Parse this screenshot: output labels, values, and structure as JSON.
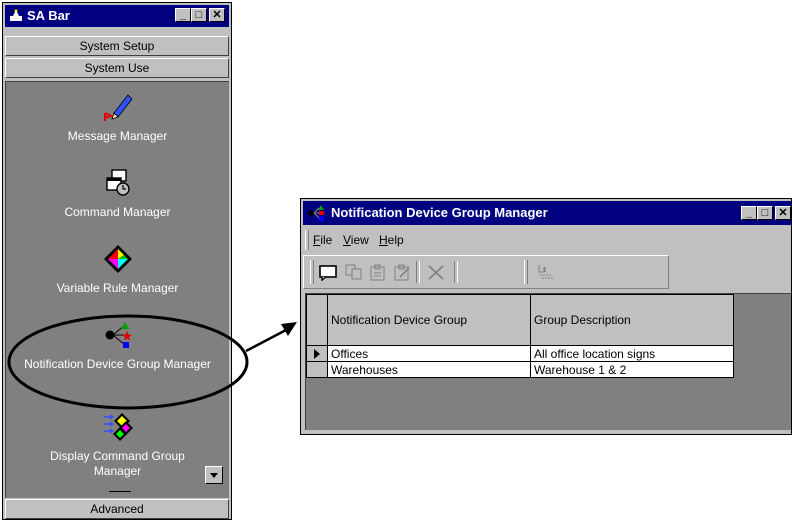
{
  "sabar": {
    "title": "SA Bar",
    "buttons": {
      "minimize": "_",
      "maximize": "□",
      "close": "✕"
    },
    "sections": [
      "System Setup",
      "System Use"
    ],
    "items": [
      {
        "label": "Message Manager",
        "icon": "pen-icon"
      },
      {
        "label": "Command Manager",
        "icon": "command-icon"
      },
      {
        "label": "Variable Rule Manager",
        "icon": "diamond-icon"
      },
      {
        "label": "Notification Device Group Manager",
        "icon": "notification-group-icon"
      },
      {
        "label": "Display Command Group Manager",
        "icon": "display-command-icon"
      }
    ],
    "footer_section": "Advanced"
  },
  "ndg_window": {
    "title": "Notification Device Group Manager",
    "buttons": {
      "minimize": "_",
      "maximize": "□",
      "close": "✕"
    },
    "menu": [
      {
        "label": "File",
        "accel": "F",
        "rest": "ile"
      },
      {
        "label": "View",
        "accel": "V",
        "rest": "iew"
      },
      {
        "label": "Help",
        "accel": "H",
        "rest": "elp"
      }
    ],
    "toolbar_icons": [
      "new-icon",
      "copy-icon",
      "properties-icon",
      "edit-icon",
      "delete-icon",
      "find-icon"
    ],
    "table": {
      "columns": [
        "Notification Device Group",
        "Group Description"
      ],
      "rows": [
        [
          "Offices",
          "All office location signs"
        ],
        [
          "Warehouses",
          "Warehouse 1 & 2"
        ]
      ]
    }
  },
  "colors": {
    "titlebar": "#000080",
    "face": "#c0c0c0",
    "panel": "#808080"
  }
}
